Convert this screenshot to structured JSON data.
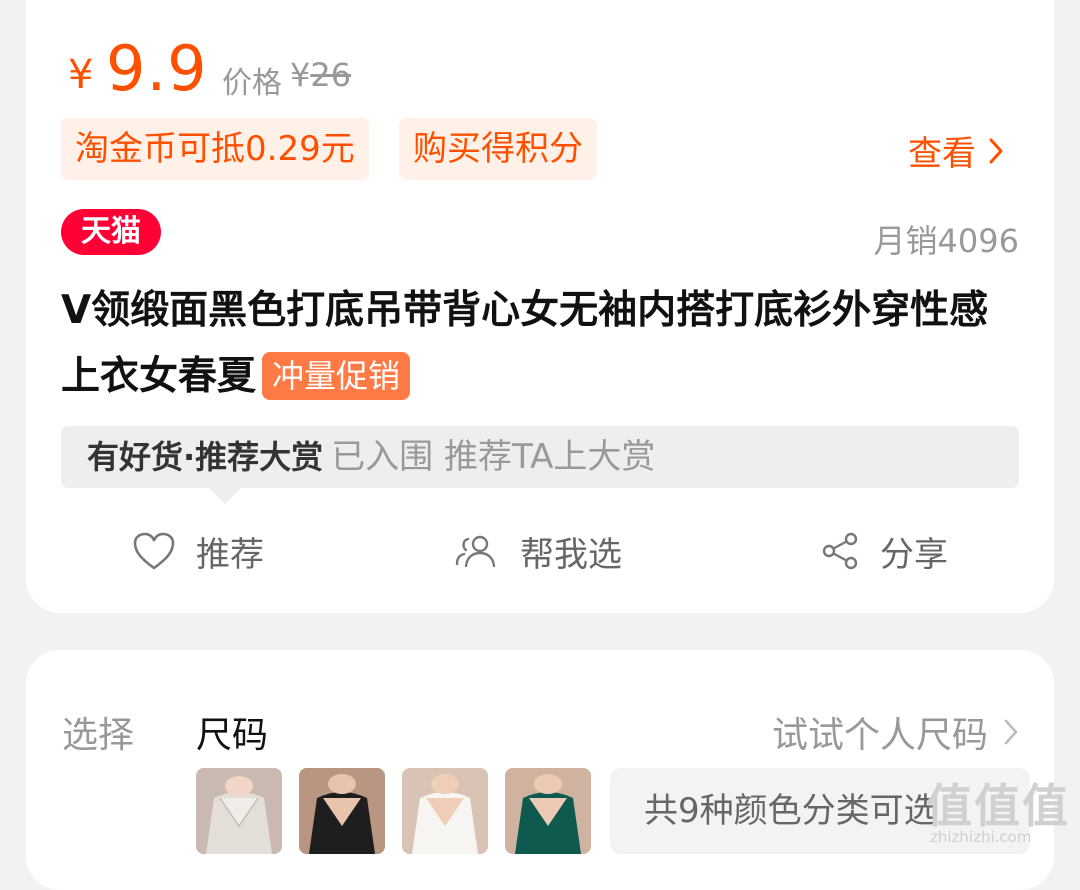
{
  "product": {
    "price_symbol": "¥",
    "price_value": "9.9",
    "original_price_label": "价格",
    "original_price_symbol": "¥",
    "original_price_value": "26",
    "tags": {
      "coin": "淘金币可抵0.29元",
      "points": "购买得积分"
    },
    "view_label": "查看",
    "platform_badge": "天猫",
    "monthly_sales": "月销4096",
    "title": "V领缎面黑色打底吊带背心女无袖内搭打底衫外穿性感上衣女春夏",
    "promo_badge": "冲量促销",
    "recommend_bar": {
      "brand": "有好货·推荐大赏",
      "status": "已入围 推荐TA上大赏"
    },
    "actions": {
      "recommend": "推荐",
      "help_choose": "帮我选",
      "share": "分享"
    }
  },
  "selection": {
    "label": "选择",
    "value": "尺码",
    "size_link": "试试个人尺码",
    "color_summary": "共9种颜色分类可选"
  },
  "watermark": {
    "glyphs": "值值值",
    "url": "zhizhizhi.com"
  },
  "colors": {
    "accent": "#ff5000",
    "tmall_red": "#ff0036",
    "promo_orange": "#ff7a45",
    "tag_background": "#fff1e8"
  },
  "icons": [
    "chevron-right-icon",
    "heart-icon",
    "people-icon",
    "share-icon"
  ]
}
